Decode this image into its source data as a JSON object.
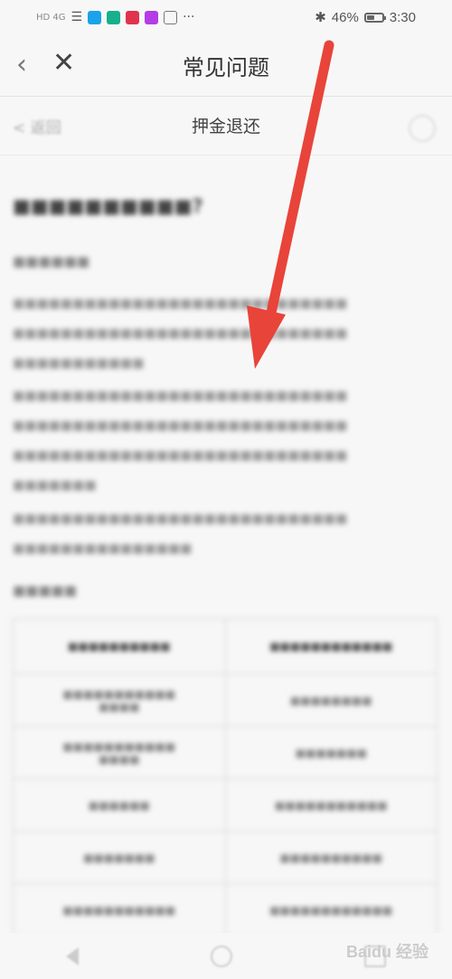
{
  "status_bar": {
    "left_text": "HD 4G",
    "battery_percent": "46%",
    "time": "3:30",
    "battery_level": 0.46
  },
  "header": {
    "title": "常见问题"
  },
  "sub_header": {
    "back_label": "< 返回",
    "title": "押金退还"
  },
  "colors": {
    "arrow": "#e8443a",
    "background": "#f7f7f7"
  },
  "watermark": {
    "text": "Baidu 经验"
  }
}
